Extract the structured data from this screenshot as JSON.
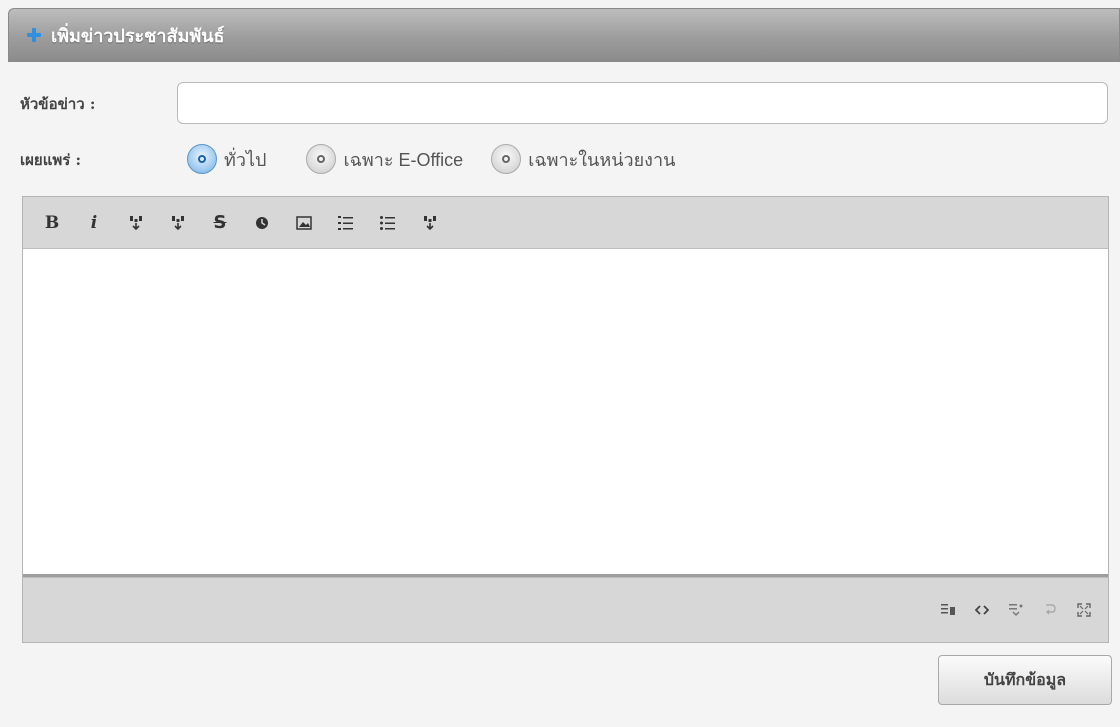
{
  "header": {
    "title": "เพิ่มข่าวประชาสัมพันธ์",
    "icon": "plus-icon",
    "accent": "#2f8fe0"
  },
  "form": {
    "title_label": "หัวข้อข่าว :",
    "title_value": "",
    "publish_label": "เผยแพร่ :",
    "publish_options": [
      {
        "label": "ทั่วไป",
        "checked": true
      },
      {
        "label": "เฉพาะ E-Office",
        "checked": false
      },
      {
        "label": "เฉพาะในหน่วยงาน",
        "checked": false
      }
    ]
  },
  "toolbar": {
    "bold": "B",
    "italic": "i",
    "strike": "S"
  },
  "statusbar": {
    "icons": [
      "word-count-icon",
      "code-view-icon",
      "format-icon",
      "undo-icon",
      "fullscreen-icon"
    ]
  },
  "actions": {
    "save_label": "บันทึกข้อมูล"
  }
}
